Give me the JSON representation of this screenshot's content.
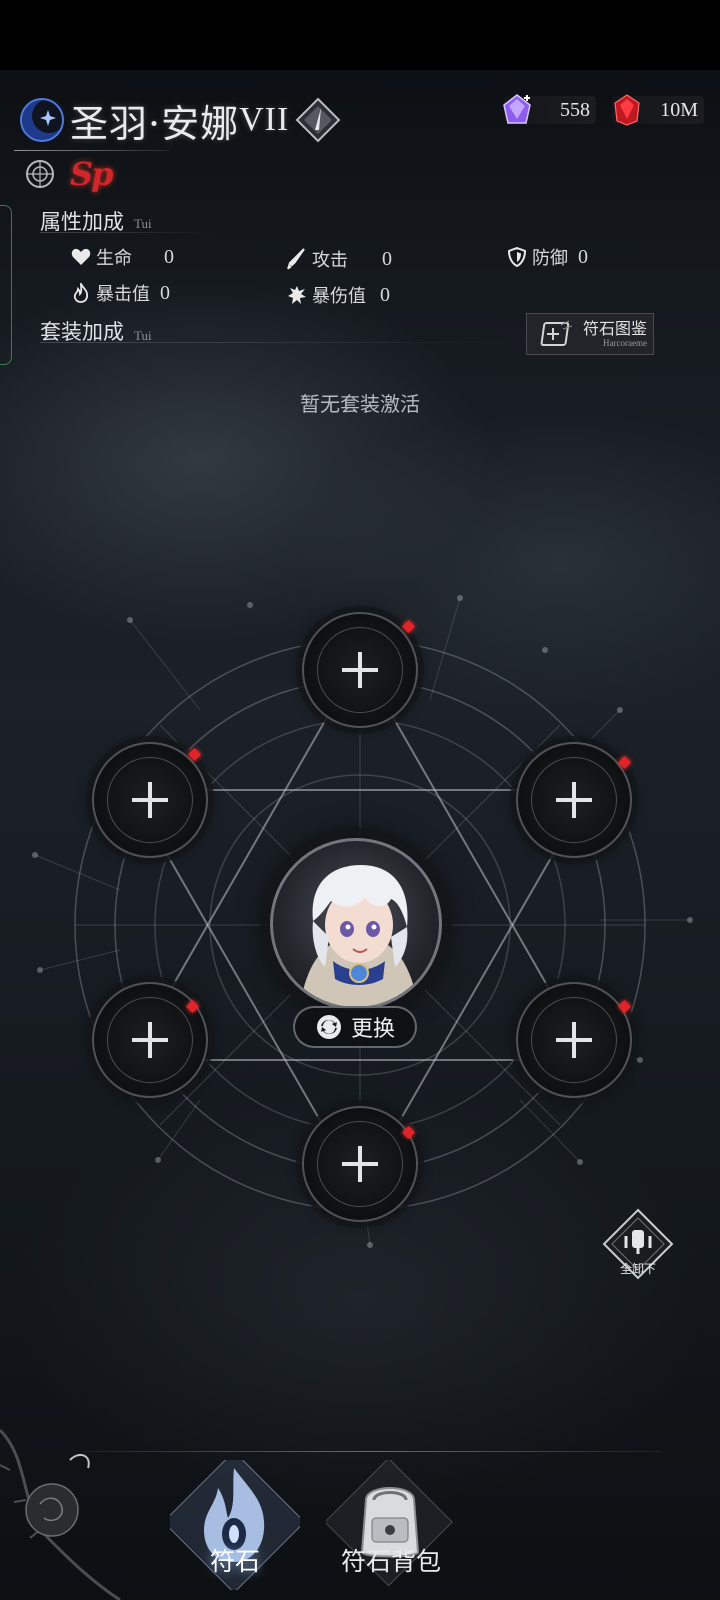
{
  "character": {
    "name": "圣羽·安娜",
    "rank": "VII",
    "tier_badge": "Sp"
  },
  "currencies": [
    {
      "icon": "purple-crystal-icon",
      "value": "558"
    },
    {
      "icon": "red-ruby-icon",
      "value": "10M"
    }
  ],
  "attributes": {
    "title": "属性加成",
    "subtitle": "Tui",
    "stats": [
      {
        "icon": "heart-icon",
        "label": "生命",
        "value": "0"
      },
      {
        "icon": "sword-icon",
        "label": "攻击",
        "value": "0"
      },
      {
        "icon": "shield-icon",
        "label": "防御",
        "value": "0"
      },
      {
        "icon": "flame-icon",
        "label": "暴击值",
        "value": "0"
      },
      {
        "icon": "burst-icon",
        "label": "暴伤值",
        "value": "0"
      }
    ]
  },
  "set_bonus": {
    "title": "套装加成",
    "subtitle": "Tui",
    "empty_text": "暂无套装激活"
  },
  "codex_button": {
    "label": "符石图鉴",
    "sublabel": "Harcoraeme"
  },
  "swap_button": {
    "label": "更换"
  },
  "unequip_all": {
    "label": "全卸下"
  },
  "nav": {
    "tabs": [
      {
        "label": "符石",
        "active": true
      },
      {
        "label": "符石背包",
        "active": false
      }
    ]
  },
  "colors": {
    "accent_red": "#e0242a",
    "text": "#e8eaee",
    "background": "#151a1f"
  }
}
